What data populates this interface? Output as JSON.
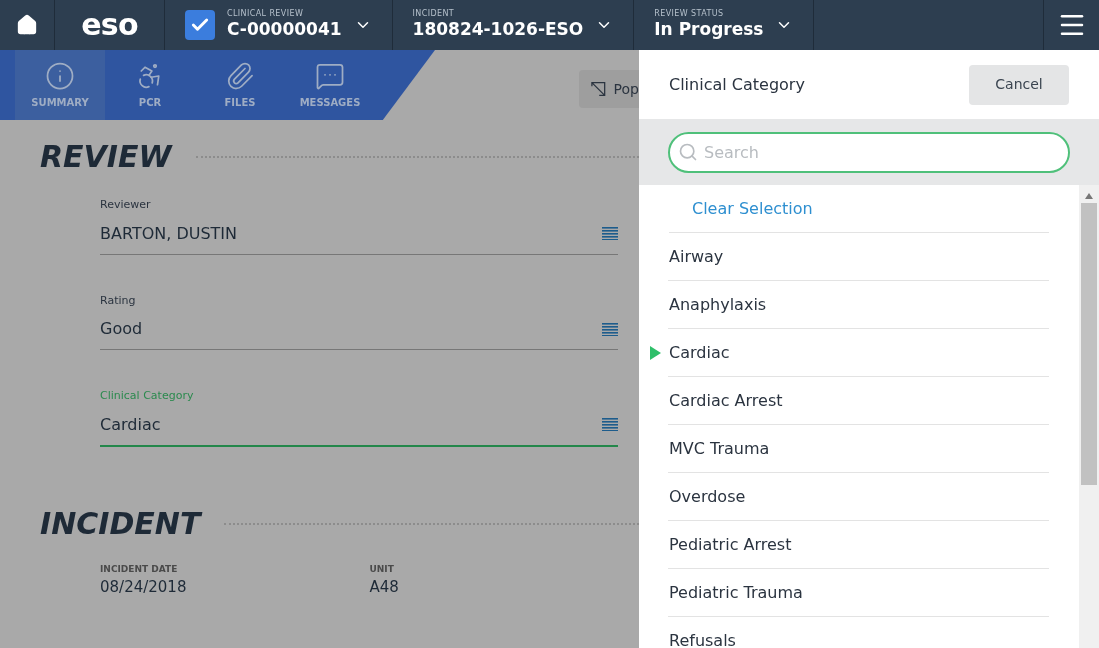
{
  "top_bar": {
    "logo": "eso",
    "selectors": [
      {
        "label": "CLINICAL REVIEW",
        "value": "C-00000041",
        "checkbox": true
      },
      {
        "label": "INCIDENT",
        "value": "180824-1026-ESO",
        "checkbox": false
      },
      {
        "label": "REVIEW STATUS",
        "value": "In Progress",
        "checkbox": false
      }
    ]
  },
  "nav_tabs": [
    {
      "label": "SUMMARY",
      "kind": "info",
      "selected": true
    },
    {
      "label": "PCR",
      "kind": "patient",
      "selected": false
    },
    {
      "label": "FILES",
      "kind": "clip",
      "selected": false
    },
    {
      "label": "MESSAGES",
      "kind": "chat",
      "selected": false
    }
  ],
  "pop_button": "Pop",
  "review": {
    "title": "REVIEW",
    "fields": [
      {
        "label": "Reviewer",
        "value": "BARTON, DUSTIN",
        "focused": false
      },
      {
        "label": "Rating",
        "value": "Good",
        "focused": false
      },
      {
        "label": "Clinical Category",
        "value": "Cardiac",
        "focused": true
      }
    ]
  },
  "incident": {
    "title": "INCIDENT",
    "fields": [
      {
        "label": "INCIDENT DATE",
        "value": "08/24/2018"
      },
      {
        "label": "UNIT",
        "value": "A48"
      }
    ]
  },
  "panel": {
    "title": "Clinical Category",
    "cancel": "Cancel",
    "search": {
      "placeholder": "Search"
    },
    "clear": "Clear Selection",
    "items": [
      {
        "label": "Airway",
        "selected": false
      },
      {
        "label": "Anaphylaxis",
        "selected": false
      },
      {
        "label": "Cardiac",
        "selected": true
      },
      {
        "label": "Cardiac Arrest",
        "selected": false
      },
      {
        "label": "MVC Trauma",
        "selected": false
      },
      {
        "label": "Overdose",
        "selected": false
      },
      {
        "label": "Pediatric Arrest",
        "selected": false
      },
      {
        "label": "Pediatric Trauma",
        "selected": false
      },
      {
        "label": "Refusals",
        "selected": false
      }
    ]
  }
}
